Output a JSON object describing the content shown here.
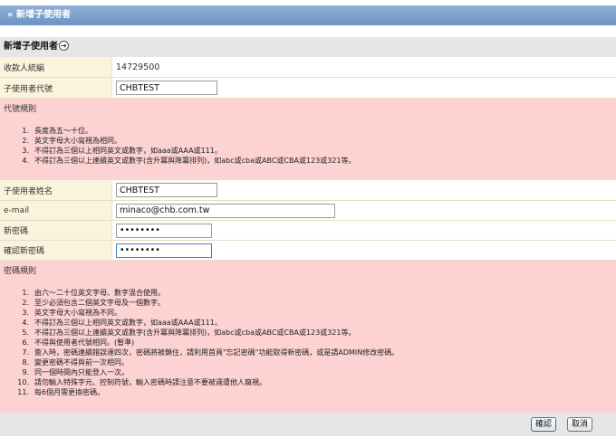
{
  "header": {
    "title": "» 新增子使用者"
  },
  "section": {
    "title": "新增子使用者",
    "info_icon": "info-arrow-icon"
  },
  "form": {
    "payee_id": {
      "label": "收款人統編",
      "value": "14729500"
    },
    "sub_user_code": {
      "label": "子使用者代號",
      "value": "CHBTEST"
    },
    "code_rules": {
      "title": "代號規則",
      "items": [
        "長度為五～十位。",
        "英文字母大小寫視為相同。",
        "不得訂為三個以上相同英文或數字，如aaa或AAA或111。",
        "不得訂為三個以上連續英文或數字(含升冪與降冪排列)，如abc或cba或ABC或CBA或123或321等。"
      ]
    },
    "sub_user_name": {
      "label": "子使用者姓名",
      "value": "CHBTEST"
    },
    "email": {
      "label": "e-mail",
      "value": "minaco@chb.com.tw"
    },
    "new_password": {
      "label": "新密碼",
      "value": "12345678"
    },
    "confirm_password": {
      "label": "確認新密碼",
      "value": "12345678"
    },
    "password_rules": {
      "title": "密碼規則",
      "items": [
        "由六～二十位英文字母、數字混合使用。",
        "至少必須包含二個英文字母及一個數字。",
        "英文字母大小寫視為不同。",
        "不得訂為三個以上相同英文或數字，如aaa或AAA或111。",
        "不得訂為三個以上連續英文或數字(含升冪與降冪排列)，如abc或cba或ABC或CBA或123或321等。",
        "不得與使用者代號相同。(暫準)",
        "簽入時，密碼連續錯誤達四次，密碼將被鎖住，請利用首頁\"忘記密碼\"功能取得新密碼，或是請ADMIN修改密碼。",
        "變更密碼不得與前一次相同。",
        "同一個時間內只能登入一次。",
        "請勿輸入特殊字元、控制符號，輸入密碼時請注意不要被週遭他人窺視。",
        "每6個月需更換密碼。"
      ]
    }
  },
  "buttons": {
    "confirm": "確認",
    "cancel": "取消"
  }
}
